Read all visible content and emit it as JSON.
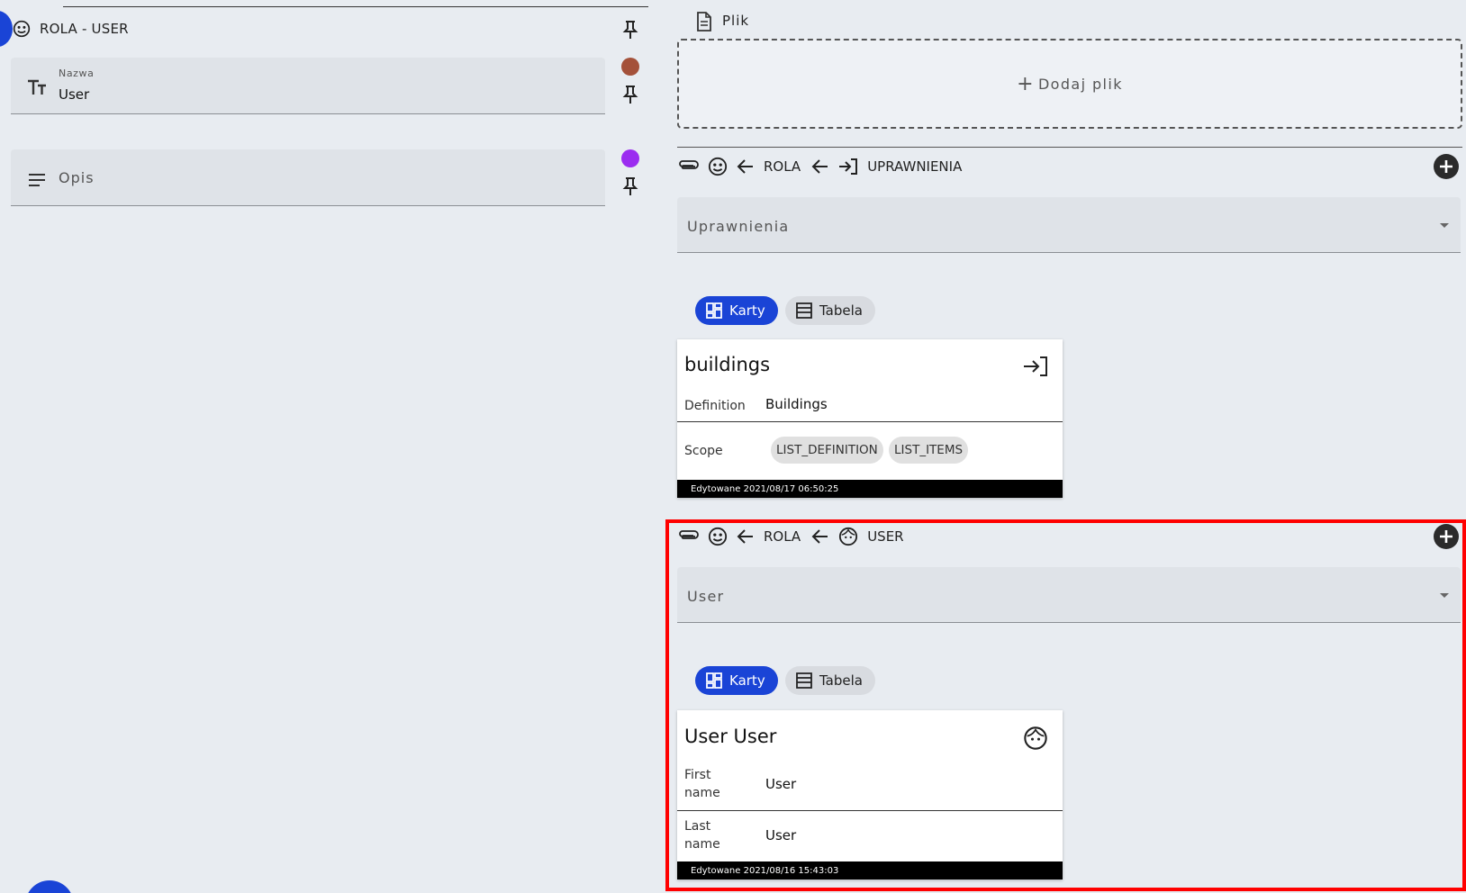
{
  "left": {
    "section_title": "ROLA - USER",
    "name_field": {
      "label": "Nazwa",
      "value": "User"
    },
    "description_field": {
      "placeholder": "Opis"
    },
    "dot_colors": [
      "#a4513a",
      "#9b2cf0"
    ]
  },
  "right": {
    "file_section": {
      "label": "Plik",
      "add_button": "Dodaj plik"
    },
    "permissions_section": {
      "crumb_rola": "ROLA",
      "crumb_target": "UPRAWNIENIA",
      "select_value": "Uprawnienia",
      "view_toggle": {
        "cards": "Karty",
        "table": "Tabela"
      },
      "card": {
        "title": "buildings",
        "rows": [
          {
            "key": "Definition",
            "value": "Buildings"
          }
        ],
        "scope_label": "Scope",
        "scope_pills": [
          "LIST_DEFINITION",
          "LIST_ITEMS"
        ],
        "footer": "Edytowane 2021/08/17 06:50:25"
      }
    },
    "user_section": {
      "crumb_rola": "ROLA",
      "crumb_target": "USER",
      "select_value": "User",
      "view_toggle": {
        "cards": "Karty",
        "table": "Tabela"
      },
      "card": {
        "title": "User User",
        "rows": [
          {
            "key": "First name",
            "value": "User"
          },
          {
            "key": "Last name",
            "value": "User"
          }
        ],
        "footer": "Edytowane 2021/08/16 15:43:03"
      }
    }
  },
  "colors": {
    "accent": "#1a44d6",
    "highlight": "#ff0000"
  }
}
